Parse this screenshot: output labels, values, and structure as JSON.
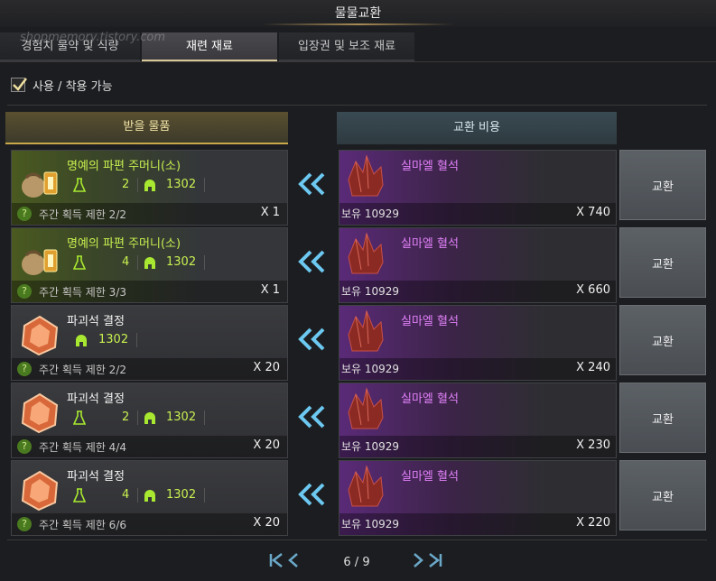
{
  "window": {
    "title": "물물교환"
  },
  "watermark": "shopmemory.tistory.com",
  "tabs": [
    {
      "label": "경험치 물약 및 식량",
      "active": false
    },
    {
      "label": "재련 재료",
      "active": true
    },
    {
      "label": "입장권 및 보조 재료",
      "active": false
    }
  ],
  "filter": {
    "label": "사용 / 착용 가능",
    "checked": true
  },
  "headers": {
    "receive": "받을 물품",
    "cost": "교환 비용"
  },
  "rows": [
    {
      "name": "명예의 파편 주머니(소)",
      "tier": "2",
      "level": "1302",
      "weekly": "주간 획득 제한 2/2",
      "qty": "X 1",
      "cost_name": "실마엘 혈석",
      "owned": "보유 10929",
      "cost_qty": "X 740",
      "button": "교환"
    },
    {
      "name": "명예의 파편 주머니(소)",
      "tier": "4",
      "level": "1302",
      "weekly": "주간 획득 제한 3/3",
      "qty": "X 1",
      "cost_name": "실마엘 혈석",
      "owned": "보유 10929",
      "cost_qty": "X 660",
      "button": "교환"
    },
    {
      "name": "파괴석 결정",
      "tier": "",
      "level": "1302",
      "weekly": "주간 획득 제한 2/2",
      "qty": "X 20",
      "cost_name": "실마엘 혈석",
      "owned": "보유 10929",
      "cost_qty": "X 240",
      "button": "교환"
    },
    {
      "name": "파괴석 결정",
      "tier": "2",
      "level": "1302",
      "weekly": "주간 획득 제한 4/4",
      "qty": "X 20",
      "cost_name": "실마엘 혈석",
      "owned": "보유 10929",
      "cost_qty": "X 230",
      "button": "교환"
    },
    {
      "name": "파괴석 결정",
      "tier": "4",
      "level": "1302",
      "weekly": "주간 획득 제한 6/6",
      "qty": "X 20",
      "cost_name": "실마엘 혈석",
      "owned": "보유 10929",
      "cost_qty": "X 220",
      "button": "교환"
    }
  ],
  "pager": {
    "text": "6 / 9"
  },
  "colors": {
    "accent_gold": "#c8a84a",
    "name_green": "#c8f050",
    "cost_purple": "#e080f8"
  }
}
